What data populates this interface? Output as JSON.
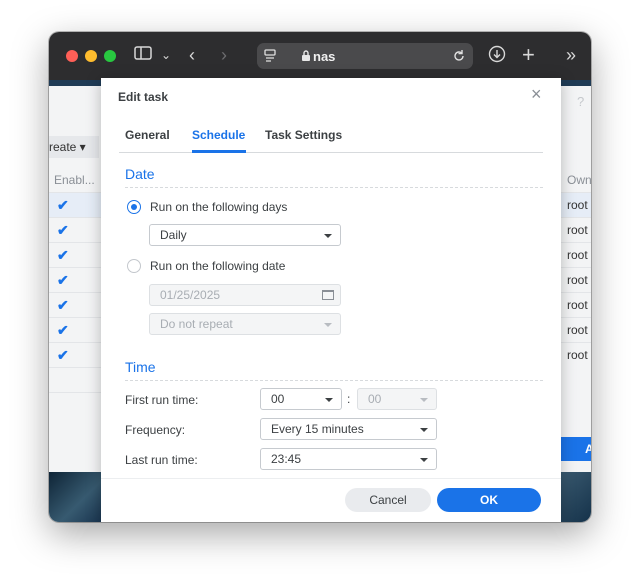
{
  "browser": {
    "url": "nas",
    "icons": [
      "close-dot",
      "minimize-dot",
      "zoom-dot",
      "sidebar-icon",
      "chevron-down-icon",
      "back-icon",
      "forward-icon",
      "page-icon",
      "lock-icon",
      "reload-icon",
      "download-icon",
      "new-tab-icon",
      "more-icon"
    ]
  },
  "background": {
    "create_label": "reate ▾",
    "enabled_header": "Enabl...",
    "owner_header": "Own",
    "owner_values": [
      "root",
      "root",
      "root",
      "root",
      "root",
      "root",
      "root"
    ],
    "help": "?",
    "blue_button_fragment": "A"
  },
  "dialog": {
    "title": "Edit task",
    "close": "×",
    "tabs": [
      "General",
      "Schedule",
      "Task Settings"
    ],
    "active_tab": "Schedule",
    "date_section": "Date",
    "run_days_label": "Run on the following days",
    "run_days_value": "Daily",
    "run_date_label": "Run on the following date",
    "date_value": "01/25/2025",
    "repeat_value": "Do not repeat",
    "time_section": "Time",
    "first_run_label": "First run time:",
    "first_run_hour": "00",
    "first_run_minute": "00",
    "colon": ":",
    "frequency_label": "Frequency:",
    "frequency_value": "Every 15 minutes",
    "last_run_label": "Last run time:",
    "last_run_value": "23:45",
    "cancel": "Cancel",
    "ok": "OK"
  },
  "colors": {
    "accent": "#1a73e8",
    "titlebar": "#2d2d2f",
    "close_dot": "#ff5f57",
    "minimize_dot": "#febc2e",
    "zoom_dot": "#28c840"
  }
}
